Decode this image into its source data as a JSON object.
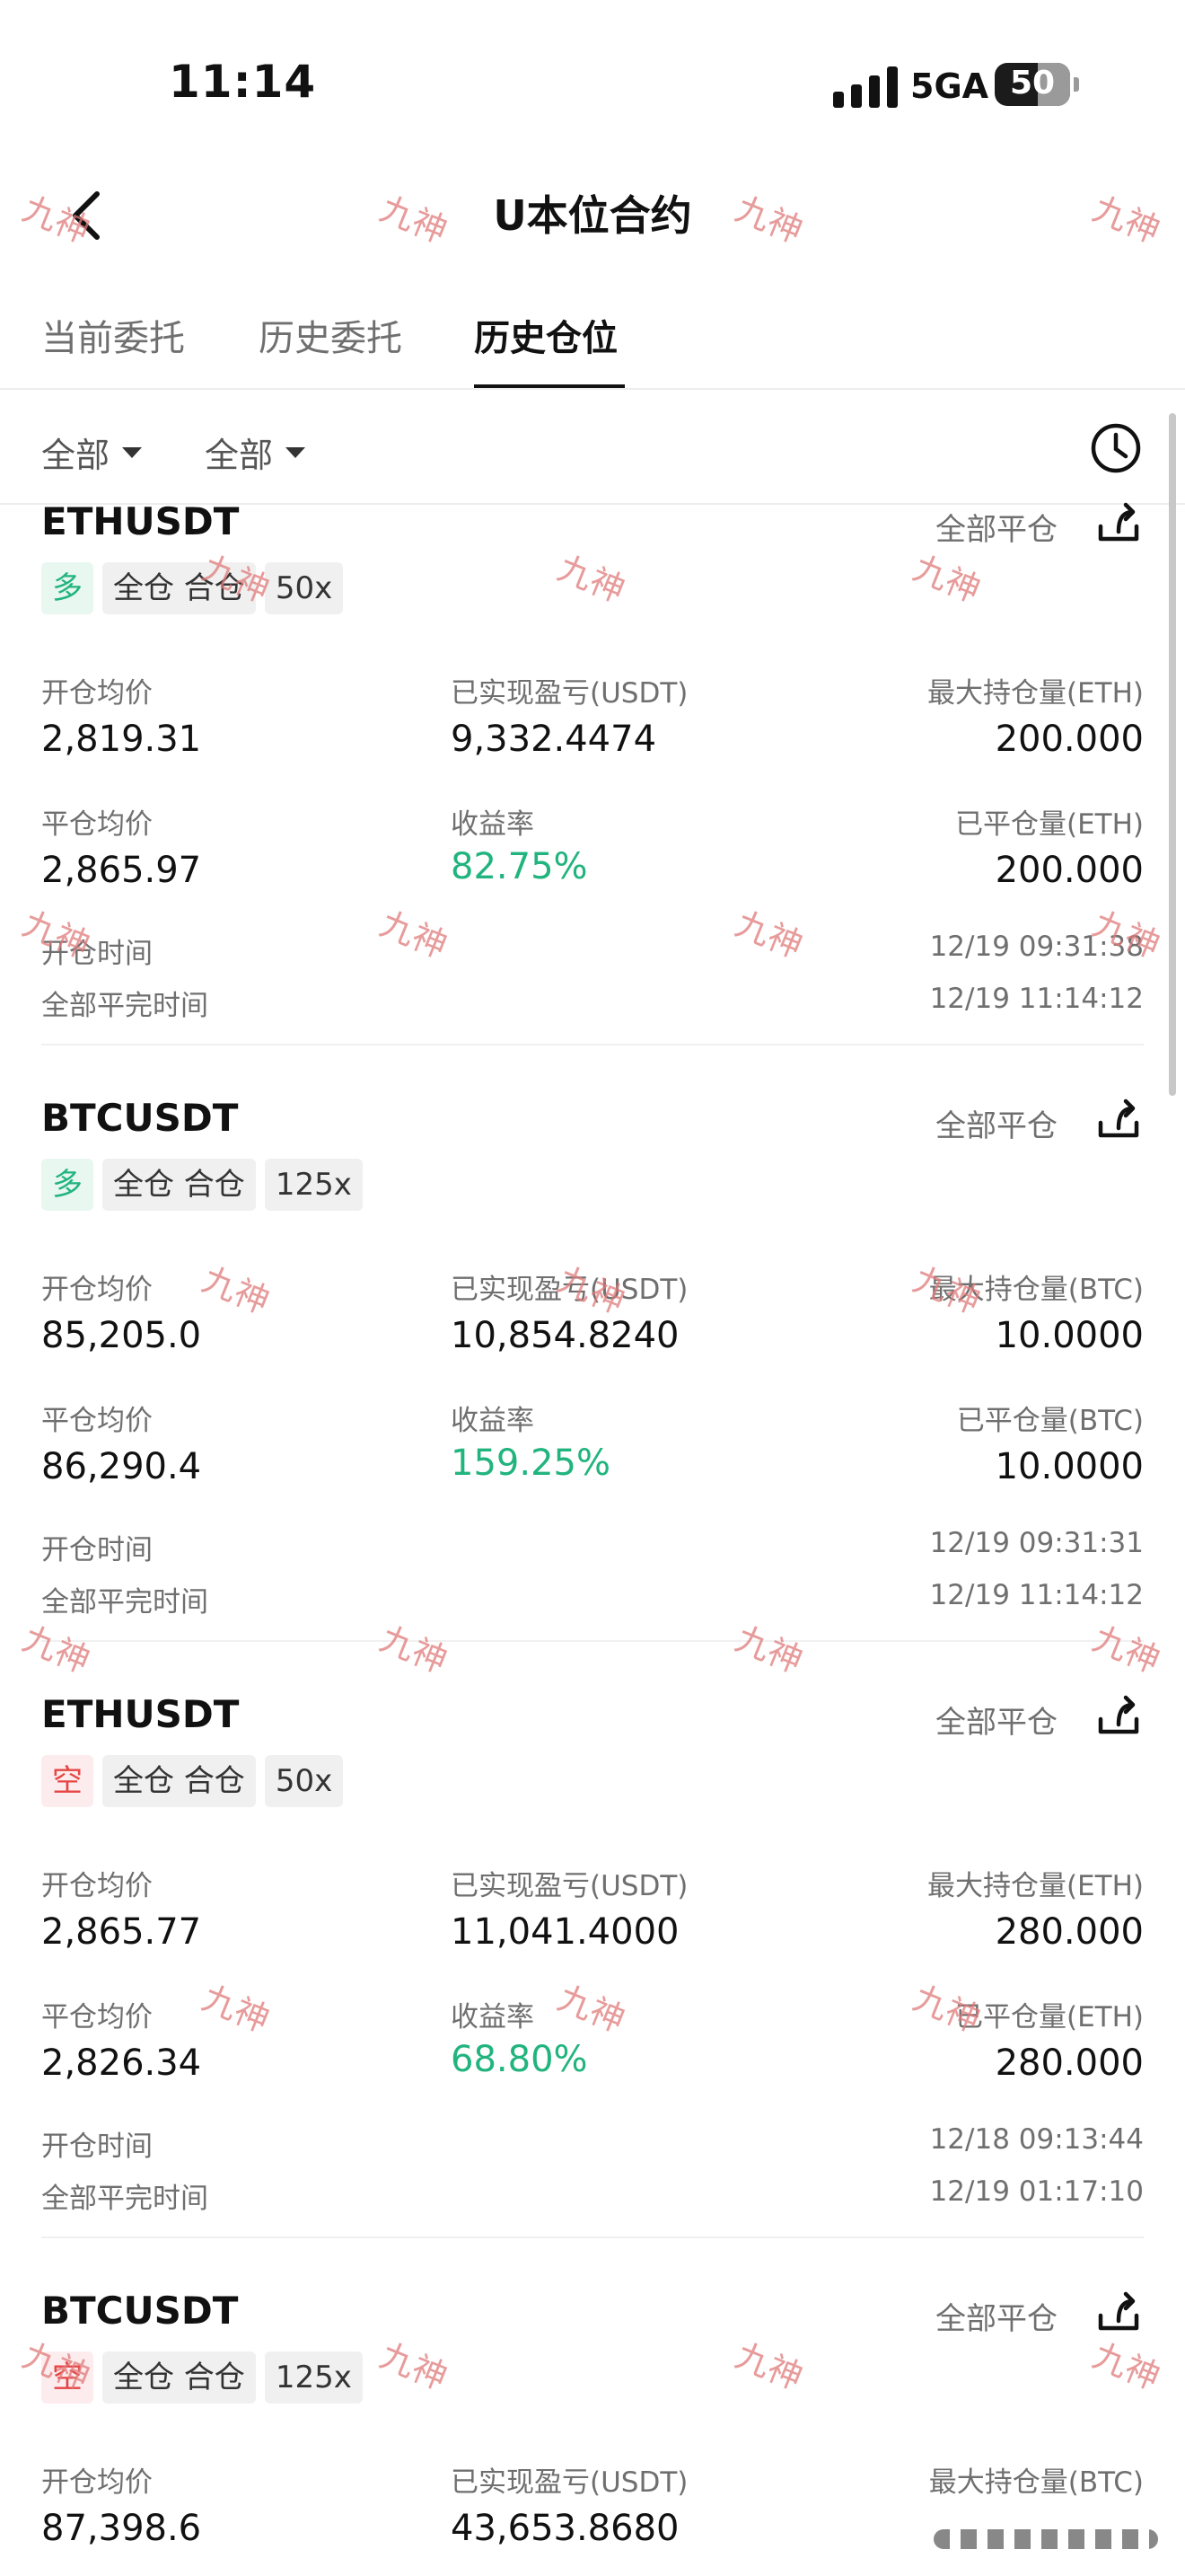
{
  "status_bar": {
    "time": "11:14",
    "network": "5GA",
    "battery": "50"
  },
  "header": {
    "title": "U本位合约"
  },
  "tabs": [
    {
      "label": "当前委托",
      "active": false
    },
    {
      "label": "历史委托",
      "active": false
    },
    {
      "label": "历史仓位",
      "active": true
    }
  ],
  "filters": [
    {
      "label": "全部"
    },
    {
      "label": "全部"
    }
  ],
  "labels": {
    "close_all": "全部平仓",
    "open_avg": "开仓均价",
    "close_avg": "平仓均价",
    "open_time": "开仓时间",
    "close_time": "全部平完时间",
    "roi": "收益率"
  },
  "positions": [
    {
      "symbol": "ETHUSDT",
      "side": "多",
      "margin": "全仓 合仓",
      "leverage": "50x",
      "open_avg": "2,819.31",
      "pnl_label": "已实现盈亏(USDT)",
      "pnl": "9,332.4474",
      "max_label": "最大持仓量(ETH)",
      "max_qty": "200.000",
      "close_avg": "2,865.97",
      "roi": "82.75%",
      "closed_label": "已平仓量(ETH)",
      "closed_qty": "200.000",
      "open_time": "12/19 09:31:38",
      "close_time": "12/19 11:14:12"
    },
    {
      "symbol": "BTCUSDT",
      "side": "多",
      "margin": "全仓 合仓",
      "leverage": "125x",
      "open_avg": "85,205.0",
      "pnl_label": "已实现盈亏(USDT)",
      "pnl": "10,854.8240",
      "max_label": "最大持仓量(BTC)",
      "max_qty": "10.0000",
      "close_avg": "86,290.4",
      "roi": "159.25%",
      "closed_label": "已平仓量(BTC)",
      "closed_qty": "10.0000",
      "open_time": "12/19 09:31:31",
      "close_time": "12/19 11:14:12"
    },
    {
      "symbol": "ETHUSDT",
      "side": "空",
      "margin": "全仓 合仓",
      "leverage": "50x",
      "open_avg": "2,865.77",
      "pnl_label": "已实现盈亏(USDT)",
      "pnl": "11,041.4000",
      "max_label": "最大持仓量(ETH)",
      "max_qty": "280.000",
      "close_avg": "2,826.34",
      "roi": "68.80%",
      "closed_label": "已平仓量(ETH)",
      "closed_qty": "280.000",
      "open_time": "12/18 09:13:44",
      "close_time": "12/19 01:17:10"
    },
    {
      "symbol": "BTCUSDT",
      "side": "空",
      "margin": "全仓 合仓",
      "leverage": "125x",
      "open_avg": "87,398.6",
      "pnl_label": "已实现盈亏(USDT)",
      "pnl": "43,653.8680",
      "max_label": "最大持仓量(BTC)",
      "max_qty": ""
    }
  ],
  "watermark": "九神",
  "colors": {
    "profit_green": "#21b47e",
    "long_green": "#21b47e",
    "short_red": "#e64545",
    "watermark": "#e07a7a"
  }
}
